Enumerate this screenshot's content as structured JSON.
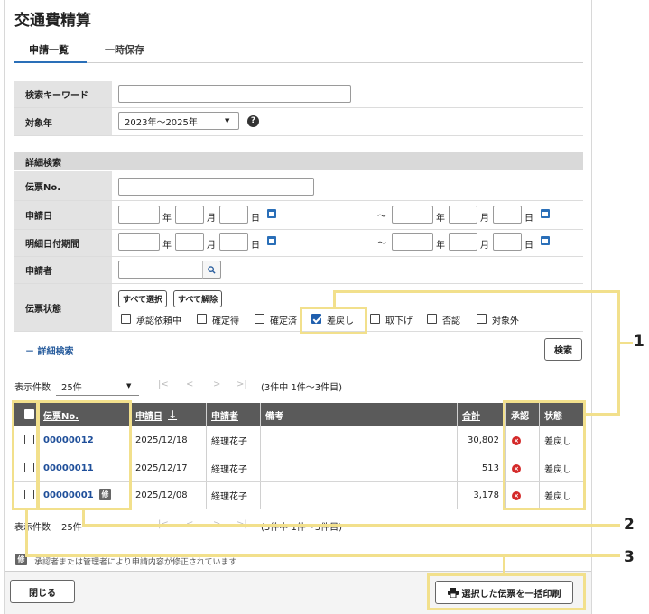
{
  "page": {
    "title": "交通費精算"
  },
  "tabs": [
    {
      "label": "申請一覧"
    },
    {
      "label": "一時保存"
    }
  ],
  "search": {
    "keyword_label": "検索キーワード",
    "keyword_value": "",
    "year_label": "対象年",
    "year_value": "2023年〜2025年",
    "help_icon": "?",
    "detail_header": "詳細検索",
    "slip_no_label": "伝票No.",
    "apply_date_label": "申請日",
    "detail_date_label": "明細日付期間",
    "applicant_label": "申請者",
    "status_label": "伝票状態",
    "unit_year": "年",
    "unit_month": "月",
    "unit_day": "日",
    "tilde": "〜",
    "select_all": "すべて選択",
    "deselect_all": "すべて解除",
    "statuses": [
      {
        "label": "承認依頼中",
        "checked": false
      },
      {
        "label": "確定待",
        "checked": false
      },
      {
        "label": "確定済",
        "checked": false
      },
      {
        "label": "差戻し",
        "checked": true
      },
      {
        "label": "取下げ",
        "checked": false
      },
      {
        "label": "否認",
        "checked": false
      },
      {
        "label": "対象外",
        "checked": false
      }
    ],
    "advanced_link": "－ 詳細検索",
    "search_button": "検索"
  },
  "pager": {
    "label": "表示件数",
    "per_page": "25件",
    "first": "|<",
    "prev": "<",
    "next": ">",
    "last": ">|",
    "summary": "(3件中 1件〜3件目)"
  },
  "table": {
    "headers": {
      "slip_no": "伝票No.",
      "apply_date": "申請日",
      "applicant": "申請者",
      "remarks": "備考",
      "total": "合計",
      "approval": "承認",
      "status": "状態"
    },
    "sort_arrow": "↓",
    "rows": [
      {
        "slip_no": "00000012",
        "apply_date": "2025/12/18",
        "applicant": "経理花子",
        "remarks": "",
        "total": "30,802",
        "approval": "×",
        "status": "差戻し",
        "modified": false
      },
      {
        "slip_no": "00000011",
        "apply_date": "2025/12/17",
        "applicant": "経理花子",
        "remarks": "",
        "total": "513",
        "approval": "×",
        "status": "差戻し",
        "modified": false
      },
      {
        "slip_no": "00000001",
        "apply_date": "2025/12/08",
        "applicant": "経理花子",
        "remarks": "",
        "total": "3,178",
        "approval": "×",
        "status": "差戻し",
        "modified": true
      }
    ]
  },
  "legend": {
    "mod_badge": "修",
    "note": "承認者または管理者により申請内容が修正されています"
  },
  "footer": {
    "close_button": "閉じる",
    "print_button": "選択した伝票を一括印刷"
  },
  "callouts": [
    "1",
    "2",
    "3"
  ],
  "colors": {
    "link": "#1f4f9a",
    "header_bg": "#5a5a5a",
    "highlight": "#f2e08c",
    "error": "#d42a2a",
    "accent": "#2a6fb8"
  }
}
